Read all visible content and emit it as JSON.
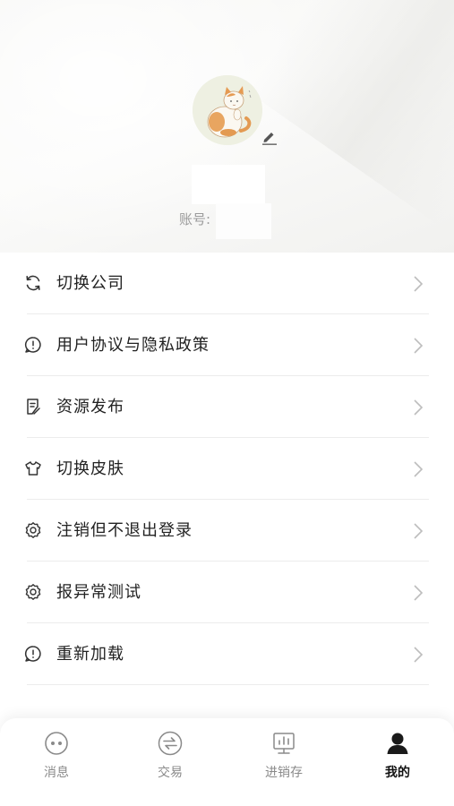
{
  "profile": {
    "account_label": "账号:",
    "avatar_icon": "cat-avatar",
    "edit_icon": "pencil-icon"
  },
  "menu": {
    "items": [
      {
        "label": "切换公司",
        "icon": "refresh-icon"
      },
      {
        "label": "用户协议与隐私政策",
        "icon": "alert-bubble-icon"
      },
      {
        "label": "资源发布",
        "icon": "document-icon"
      },
      {
        "label": "切换皮肤",
        "icon": "tshirt-icon"
      },
      {
        "label": "注销但不退出登录",
        "icon": "gear-icon"
      },
      {
        "label": "报异常测试",
        "icon": "gear-icon"
      },
      {
        "label": "重新加载",
        "icon": "alert-bubble-icon"
      }
    ]
  },
  "tabbar": {
    "tabs": [
      {
        "label": "消息",
        "icon": "chat-icon",
        "active": false
      },
      {
        "label": "交易",
        "icon": "exchange-icon",
        "active": false
      },
      {
        "label": "进销存",
        "icon": "chart-board-icon",
        "active": false
      },
      {
        "label": "我的",
        "icon": "user-icon",
        "active": true
      }
    ]
  },
  "colors": {
    "text": "#222222",
    "muted": "#8a8a8a",
    "divider": "#ececec",
    "active_tab": "#111111"
  }
}
